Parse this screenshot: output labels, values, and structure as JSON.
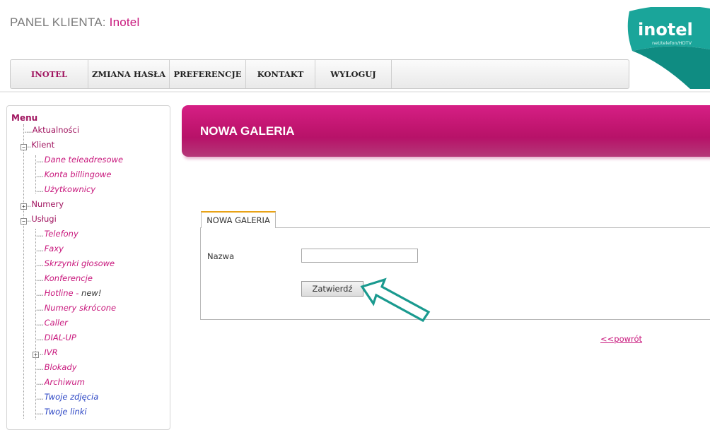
{
  "header": {
    "title_prefix": "PANEL KLIENTA:",
    "title_brand": "Inotel"
  },
  "logo": {
    "text": "inotel",
    "tagline": "net/telefon/HDTV"
  },
  "nav": {
    "items": [
      {
        "label": "INOTEL"
      },
      {
        "label": "ZMIANA HASŁA"
      },
      {
        "label": "PREFERENCJE"
      },
      {
        "label": "KONTAKT"
      },
      {
        "label": "WYLOGUJ"
      }
    ]
  },
  "sidebar": {
    "title": "Menu",
    "items": [
      {
        "label": "Aktualności"
      },
      {
        "label": "Klient"
      },
      {
        "label": "Dane teleadresowe"
      },
      {
        "label": "Konta billingowe"
      },
      {
        "label": "Użytkownicy"
      },
      {
        "label": "Numery"
      },
      {
        "label": "Usługi"
      },
      {
        "label": "Telefony"
      },
      {
        "label": "Faxy"
      },
      {
        "label": "Skrzynki głosowe"
      },
      {
        "label": "Konferencje"
      },
      {
        "label": "Hotline - ",
        "badge": "new!"
      },
      {
        "label": "Numery skrócone"
      },
      {
        "label": "Caller"
      },
      {
        "label": "DIAL-UP"
      },
      {
        "label": "IVR"
      },
      {
        "label": "Blokady"
      },
      {
        "label": "Archiwum"
      },
      {
        "label": "Twoje zdjęcia"
      },
      {
        "label": "Twoje linki"
      }
    ]
  },
  "main": {
    "banner_title": "NOWA GALERIA",
    "tab_label": "NOWA GALERIA",
    "form": {
      "name_label": "Nazwa",
      "name_value": "",
      "submit_label": "Zatwierdź"
    },
    "back_link": "<<powrót"
  },
  "colors": {
    "accent": "#c8177c",
    "banner": "#c0156f",
    "tab_border_top": "#e8a317",
    "arrow": "#1a9a8f"
  }
}
